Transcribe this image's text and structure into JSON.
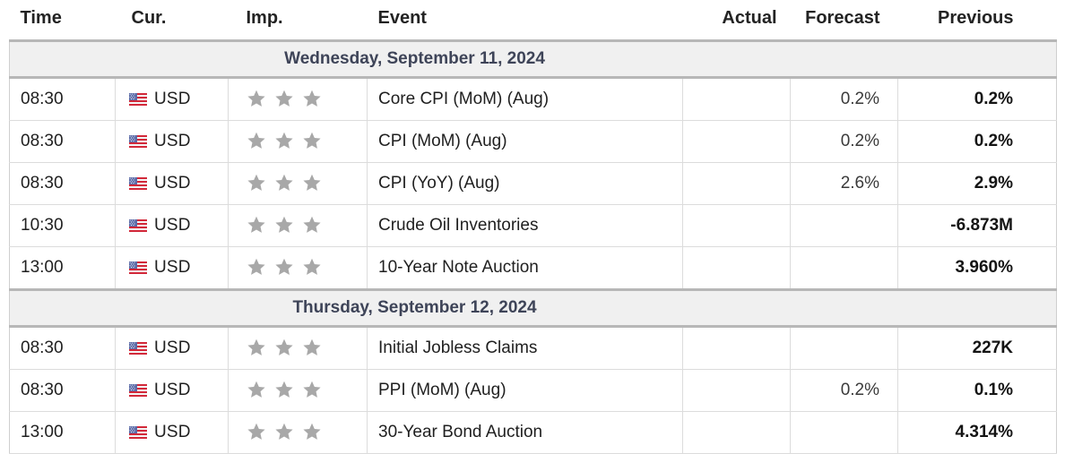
{
  "table": {
    "columns": [
      {
        "key": "time",
        "label": "Time",
        "align": "left"
      },
      {
        "key": "cur",
        "label": "Cur.",
        "align": "left"
      },
      {
        "key": "imp",
        "label": "Imp.",
        "align": "left"
      },
      {
        "key": "event",
        "label": "Event",
        "align": "left"
      },
      {
        "key": "actual",
        "label": "Actual",
        "align": "right"
      },
      {
        "key": "forecast",
        "label": "Forecast",
        "align": "right"
      },
      {
        "key": "previous",
        "label": "Previous",
        "align": "right"
      }
    ]
  },
  "colors": {
    "day_header_bg": "#f0f0f0",
    "day_header_text": "#3e4458",
    "star_filled": "#a8a8a8",
    "row_border": "#dcdcdc",
    "section_border": "#b7b7b7",
    "text": "#1f1f1f"
  },
  "icons": {
    "flag": "us-flag-icon",
    "star": "star-icon"
  },
  "days": [
    {
      "date_label": "Wednesday, September 11, 2024",
      "rows": [
        {
          "time": "08:30",
          "currency": "USD",
          "importance": 3,
          "event": "Core CPI (MoM) (Aug)",
          "actual": "",
          "forecast": "0.2%",
          "previous": "0.2%"
        },
        {
          "time": "08:30",
          "currency": "USD",
          "importance": 3,
          "event": "CPI (MoM) (Aug)",
          "actual": "",
          "forecast": "0.2%",
          "previous": "0.2%"
        },
        {
          "time": "08:30",
          "currency": "USD",
          "importance": 3,
          "event": "CPI (YoY) (Aug)",
          "actual": "",
          "forecast": "2.6%",
          "previous": "2.9%"
        },
        {
          "time": "10:30",
          "currency": "USD",
          "importance": 3,
          "event": "Crude Oil Inventories",
          "actual": "",
          "forecast": "",
          "previous": "-6.873M"
        },
        {
          "time": "13:00",
          "currency": "USD",
          "importance": 3,
          "event": "10-Year Note Auction",
          "actual": "",
          "forecast": "",
          "previous": "3.960%"
        }
      ]
    },
    {
      "date_label": "Thursday, September 12, 2024",
      "rows": [
        {
          "time": "08:30",
          "currency": "USD",
          "importance": 3,
          "event": "Initial Jobless Claims",
          "actual": "",
          "forecast": "",
          "previous": "227K"
        },
        {
          "time": "08:30",
          "currency": "USD",
          "importance": 3,
          "event": "PPI (MoM) (Aug)",
          "actual": "",
          "forecast": "0.2%",
          "previous": "0.1%"
        },
        {
          "time": "13:00",
          "currency": "USD",
          "importance": 3,
          "event": "30-Year Bond Auction",
          "actual": "",
          "forecast": "",
          "previous": "4.314%"
        }
      ]
    }
  ]
}
